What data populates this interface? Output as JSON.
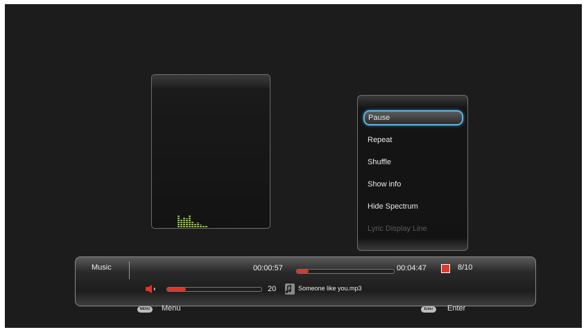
{
  "menu": {
    "items": [
      {
        "label": "Pause",
        "state": "active"
      },
      {
        "label": "Repeat",
        "state": "normal"
      },
      {
        "label": "Shuffle",
        "state": "normal"
      },
      {
        "label": "Show info",
        "state": "normal"
      },
      {
        "label": "Hide Spectrum",
        "state": "normal"
      },
      {
        "label": "Lyric Display Line",
        "state": "disabled"
      }
    ]
  },
  "player": {
    "section_label": "Music",
    "elapsed": "00:00:57",
    "total": "00:04:47",
    "progress": 0.12,
    "track_position": "8/10",
    "volume": "20",
    "volume_level": 0.2,
    "song": "Someone like you.mp3"
  },
  "hints": {
    "menu_key": "MENU",
    "menu_label": "Menu",
    "enter_key": "Enter",
    "enter_label": "Enter"
  },
  "spectrum": {
    "levels": [
      0.85,
      0.6,
      0.75,
      0.65,
      0.9,
      0.45,
      0.3,
      0.35,
      0.2,
      0.15,
      0.15
    ]
  },
  "colors": {
    "accent": "#e43225",
    "focus": "#5bb6e6",
    "spectrum": "#8fb53a",
    "background": "#1c1c1c"
  }
}
